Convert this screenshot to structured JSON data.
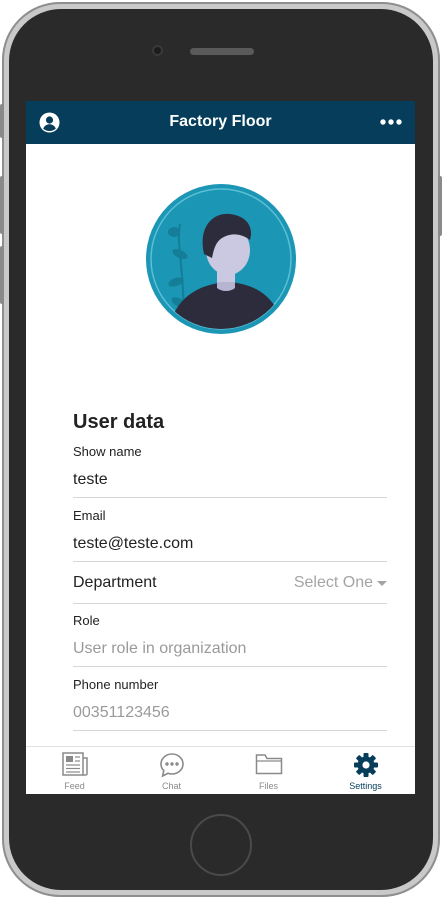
{
  "appbar": {
    "title": "Factory Floor",
    "profile_icon": "account-circle-icon",
    "more_icon": "more-horizontal-icon",
    "color": "#053d5a"
  },
  "profile": {
    "avatar_icon": "user-avatar-illustration",
    "accent": "#1b96b5"
  },
  "user_data": {
    "title": "User data",
    "show_name": {
      "label": "Show name",
      "value": "teste"
    },
    "email": {
      "label": "Email",
      "value": "teste@teste.com"
    },
    "department": {
      "label": "Department",
      "selected": "Select One"
    },
    "role": {
      "label": "Role",
      "placeholder": "User role in organization"
    },
    "phone": {
      "label": "Phone number",
      "placeholder": "00351123456"
    }
  },
  "tabs": [
    {
      "label": "Feed",
      "icon": "newspaper-icon",
      "active": false
    },
    {
      "label": "Chat",
      "icon": "chat-bubble-icon",
      "active": false
    },
    {
      "label": "Files",
      "icon": "folder-icon",
      "active": false
    },
    {
      "label": "Settings",
      "icon": "gear-icon",
      "active": true
    }
  ]
}
